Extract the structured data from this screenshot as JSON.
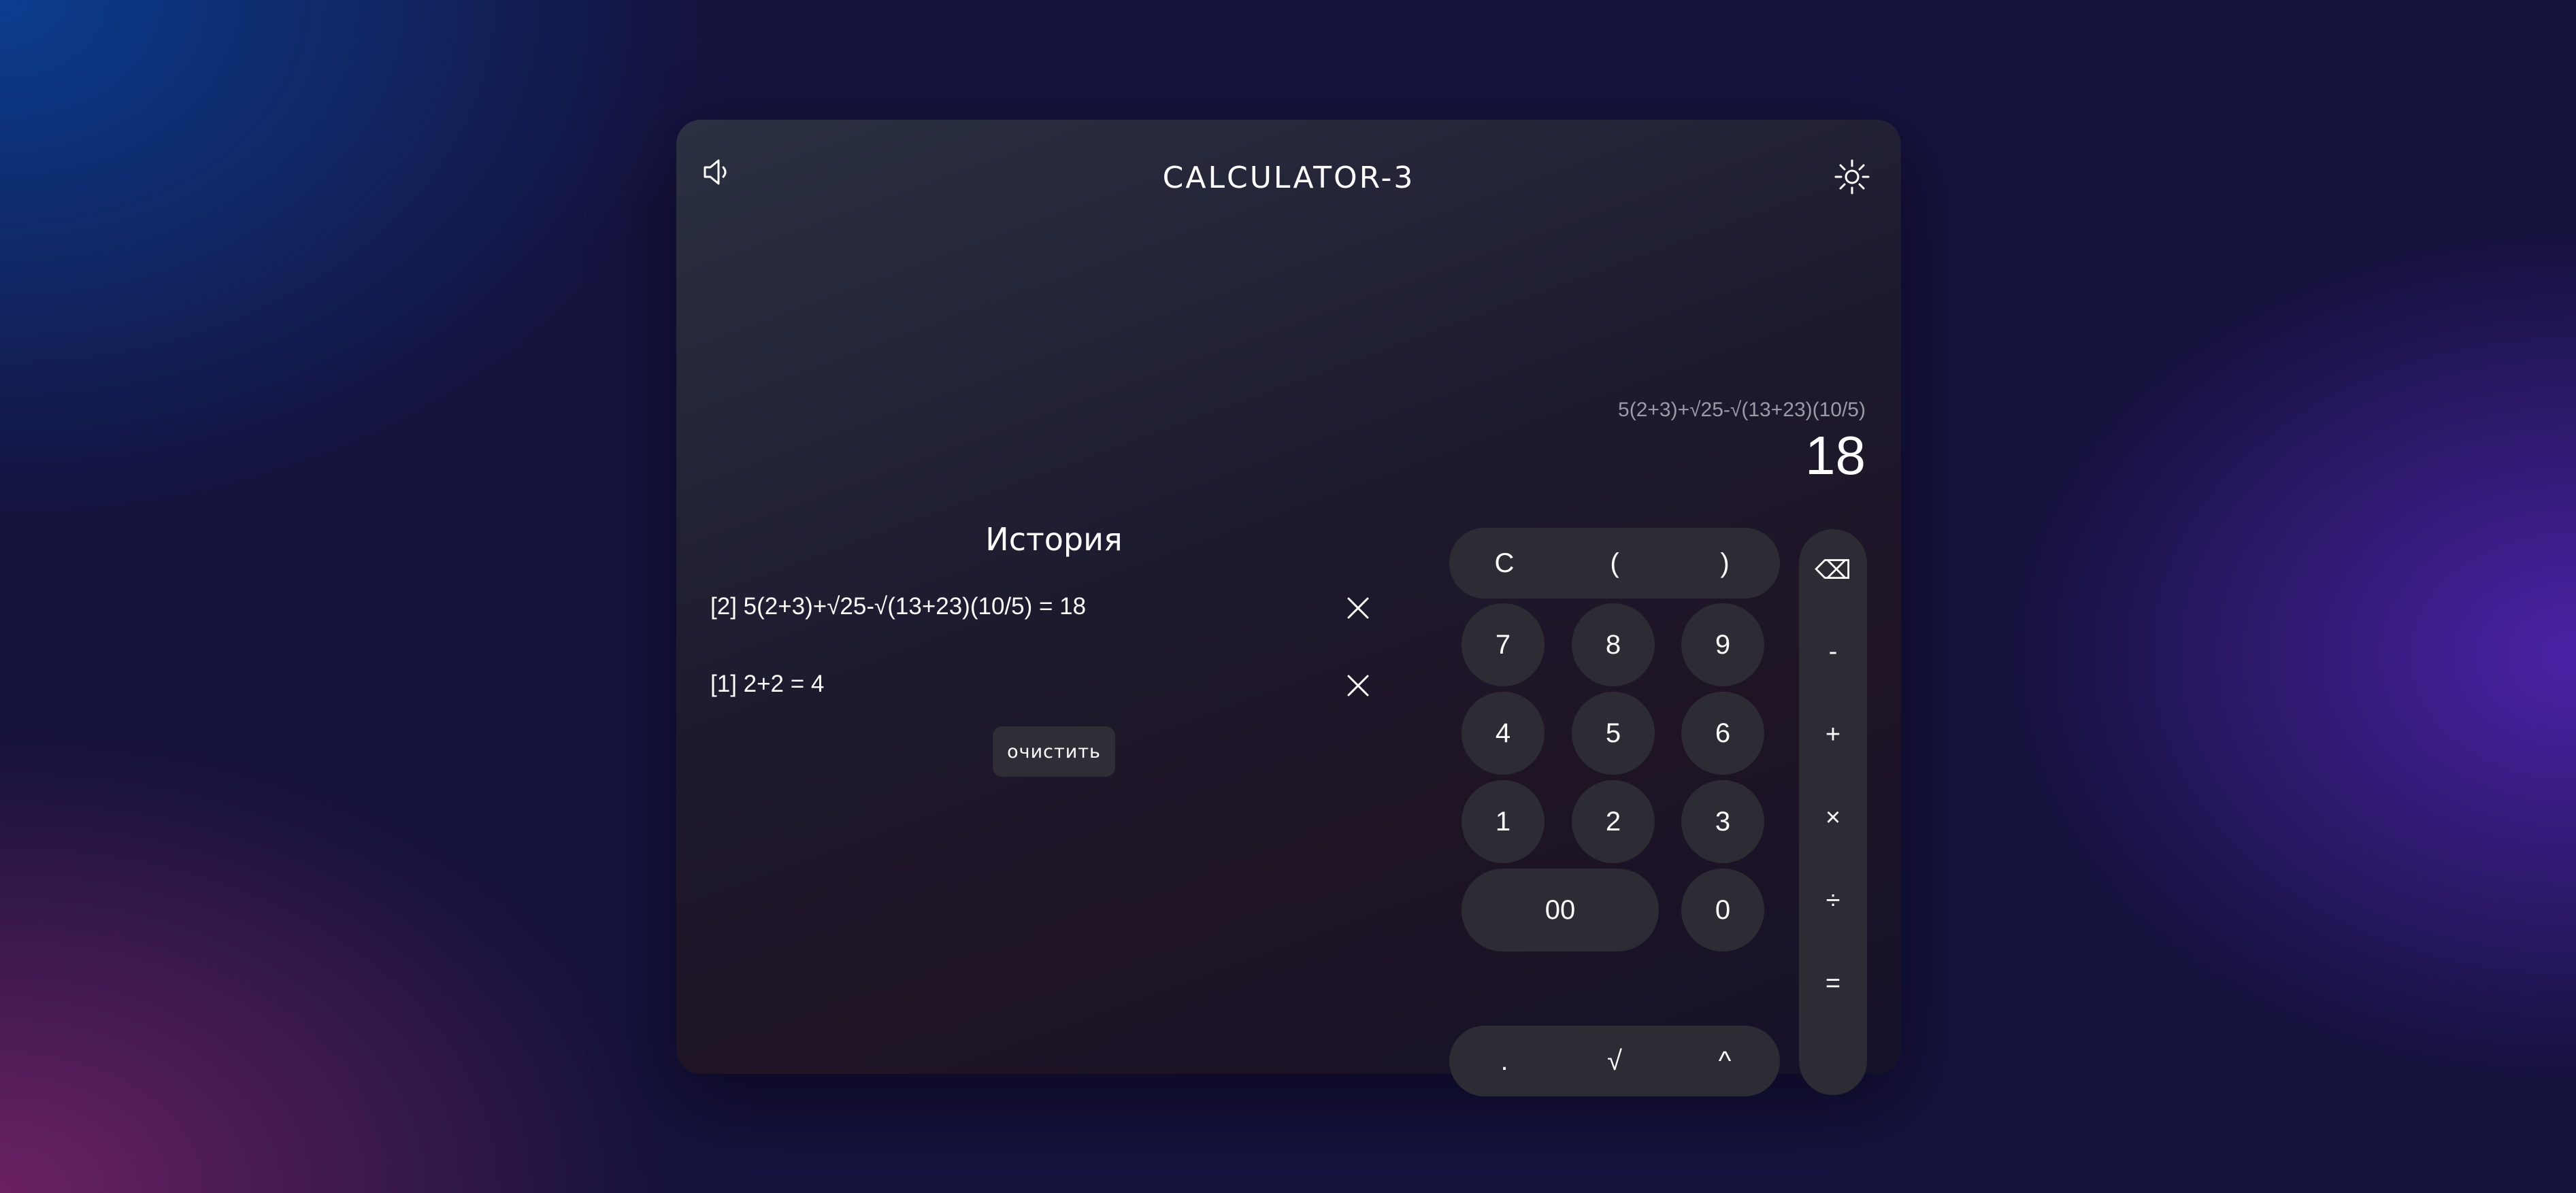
{
  "app": {
    "title": "CALCULATOR-3"
  },
  "display": {
    "expression": "5(2+3)+√25-√(13+23)(10/5)",
    "result": "18"
  },
  "history": {
    "title": "История",
    "items": [
      {
        "text": "[2] 5(2+3)+√25-√(13+23)(10/5) = 18"
      },
      {
        "text": "[1] 2+2 = 4"
      }
    ],
    "clear_label": "очистить"
  },
  "keypad": {
    "top_row": [
      "C",
      "(",
      ")"
    ],
    "digits": {
      "seven": "7",
      "eight": "8",
      "nine": "9",
      "four": "4",
      "five": "5",
      "six": "6",
      "one": "1",
      "two": "2",
      "three": "3",
      "double_zero": "00",
      "zero": "0"
    },
    "bottom_row": [
      ".",
      "√",
      "^"
    ],
    "operators": {
      "backspace": "⌫",
      "minus": "-",
      "plus": "+",
      "multiply": "×",
      "divide": "÷",
      "equals": "="
    }
  },
  "icons": {
    "sound": "speaker-icon",
    "theme": "sun-icon",
    "delete": "close-icon"
  },
  "colors": {
    "key_background": "#2d2c34",
    "text": "#ffffff",
    "expression_text": "#9b9ba8"
  }
}
